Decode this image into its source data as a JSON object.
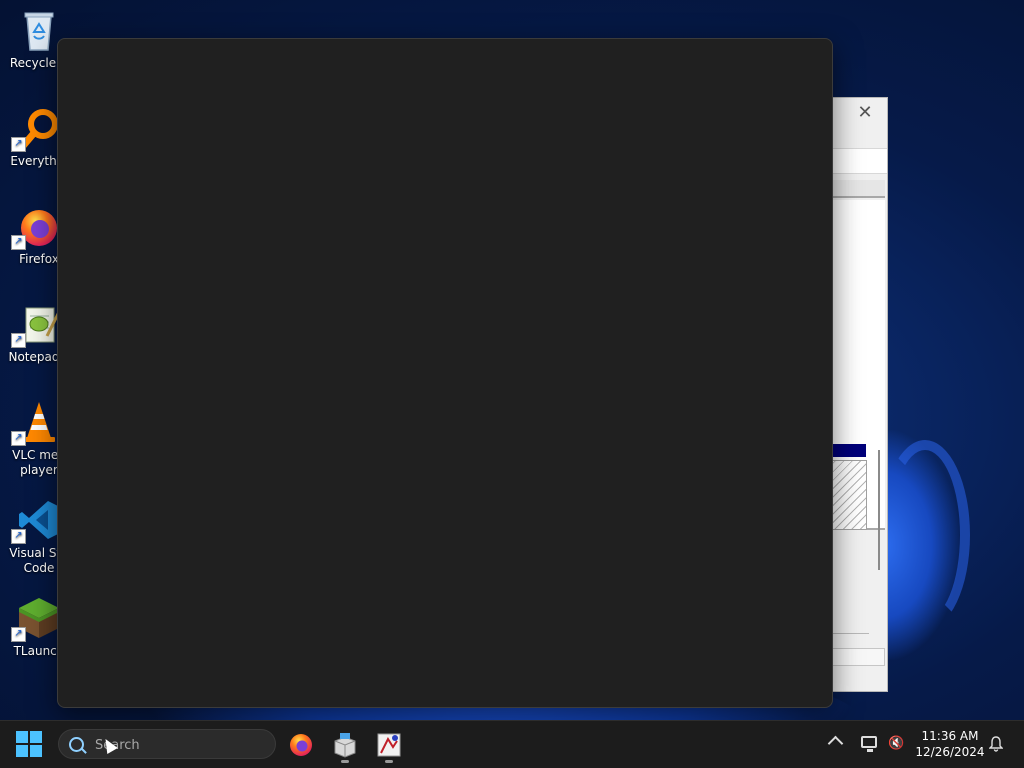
{
  "desktop": {
    "icons": [
      {
        "label": "Recycle B",
        "icon": "recycle-bin-icon"
      },
      {
        "label": "Everythin",
        "icon": "magnifier-icon"
      },
      {
        "label": "Firefox",
        "icon": "firefox-icon"
      },
      {
        "label": "Notepad+",
        "icon": "notepad-plus-plus-icon"
      },
      {
        "label": "VLC med\nplayer",
        "icon": "vlc-cone-icon"
      },
      {
        "label": "Visual Stu\nCode",
        "icon": "vscode-icon"
      },
      {
        "label": "TLaunch",
        "icon": "minecraft-grass-block-icon"
      }
    ]
  },
  "background_window": {
    "close_glyph": "✕",
    "selection_color": "#00007a"
  },
  "taskbar": {
    "search_placeholder": "Search",
    "apps": [
      {
        "name": "Firefox",
        "icon": "firefox-icon"
      },
      {
        "name": "Installer",
        "icon": "installer-box-icon"
      },
      {
        "name": "Paint application",
        "icon": "paint-app-icon"
      }
    ],
    "time": "11:36 AM",
    "date": "12/26/2024"
  },
  "colors": {
    "accent": "#4cc2ff",
    "dark_window": "#202020",
    "taskbar": "#1c1c1c"
  }
}
